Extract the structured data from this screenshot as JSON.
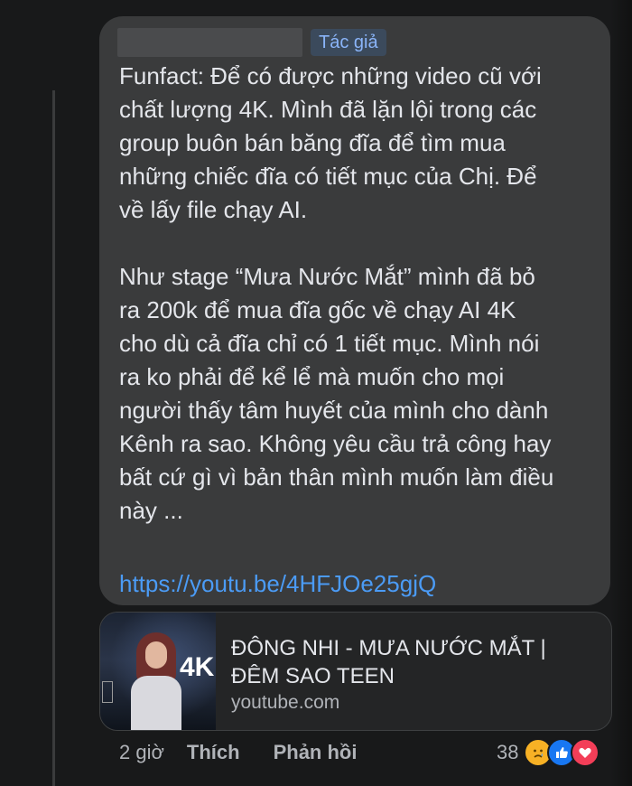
{
  "comment": {
    "author_badge": "Tác giả",
    "text": "Funfact: Để có được những video cũ với\nchất lượng 4K. Mình đã lặn lội trong các\ngroup buôn bán băng đĩa để tìm mua\nnhững chiếc đĩa có tiết mục của Chị. Để\nvề lấy file chạy AI.\n\nNhư stage “Mưa Nước Mắt” mình đã bỏ\nra 200k để mua đĩa gốc về chạy AI 4K\ncho dù cả đĩa chỉ có 1 tiết mục. Mình nói\nra ko phải để kể lể mà muốn cho mọi\nngười thấy tâm huyết của mình cho dành\nKênh ra sao. Không yêu cầu trả công hay\nbất cứ gì vì bản thân mình muốn làm điều\nnày ...",
    "link": "https://youtu.be/4HFJOe25gjQ"
  },
  "link_card": {
    "title": "ĐÔNG NHI - MƯA NƯỚC MẮT |\nĐÊM SAO TEEN",
    "domain": "youtube.com",
    "thumbnail_badge": "4K"
  },
  "actions": {
    "time": "2 giờ",
    "like": "Thích",
    "reply": "Phản hồi"
  },
  "reactions": {
    "count": "38",
    "icons": [
      "sad-icon",
      "like-icon",
      "love-icon"
    ],
    "colors": {
      "sad": "#f7b125",
      "like": "#1877f2",
      "love": "#f33e58"
    }
  },
  "colors": {
    "background": "#18191a",
    "bubble": "#3a3b3c",
    "text": "#e4e6eb",
    "link": "#4b9bf5",
    "muted": "#b0b3b8"
  }
}
